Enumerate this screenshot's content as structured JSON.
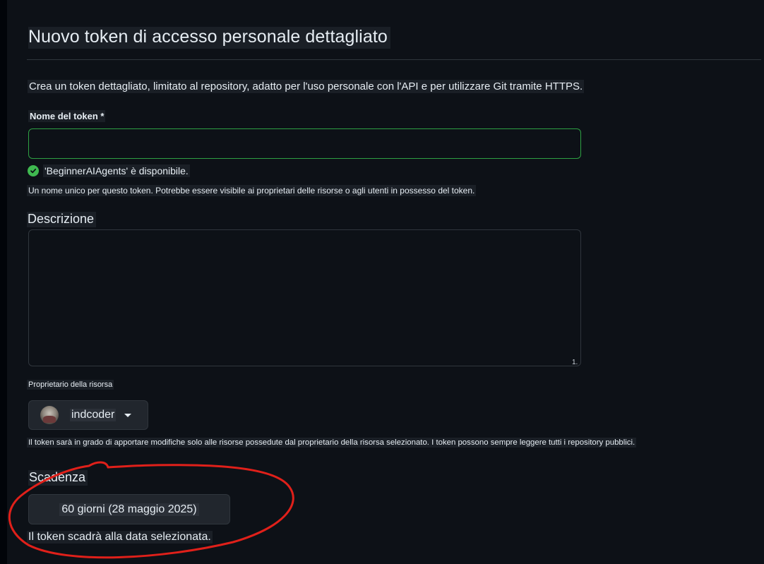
{
  "page": {
    "title": "Nuovo token di accesso personale dettagliato",
    "lead": "Crea un token dettagliato, limitato al repository, adatto per l'uso personale con l'API e per utilizzare Git tramite HTTPS."
  },
  "token_name": {
    "label": "Nome del token *",
    "value": "",
    "availability": "'BeginnerAIAgents' è disponibile.",
    "hint": "Un nome unico per questo token. Potrebbe essere visibile ai proprietari delle risorse o agli utenti in possesso del token."
  },
  "description": {
    "label": "Descrizione",
    "value": "",
    "resize_mark": "1."
  },
  "owner": {
    "label": "Proprietario della risorsa",
    "selected": "indcoder",
    "hint": "Il token sarà in grado di apportare modifiche solo alle risorse possedute dal proprietario della risorsa selezionato. I token possono sempre leggere tutti i repository pubblici."
  },
  "expiration": {
    "label": "Scadenza",
    "selected": "60 giorni (28 maggio 2025)",
    "hint": "Il token scadrà alla data selezionata."
  },
  "icons": {
    "check": "check-circle-icon",
    "caret": "caret-down-icon",
    "avatar": "user-avatar"
  },
  "colors": {
    "background": "#0d1117",
    "success": "#3fb950",
    "focus_border": "#2ea043",
    "annotation": "#e0201a"
  }
}
